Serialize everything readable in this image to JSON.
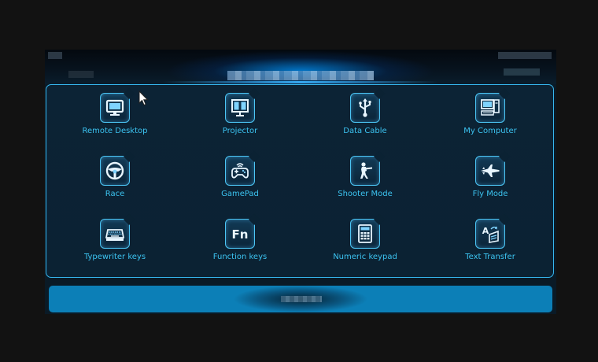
{
  "colors": {
    "accent": "#3cc3f0",
    "panel_bg": "#0b2233",
    "bottom_bar": "#0c7fb7"
  },
  "modes": [
    {
      "label": "Remote Desktop",
      "icon": "monitor-icon"
    },
    {
      "label": "Projector",
      "icon": "projector-icon"
    },
    {
      "label": "Data Cable",
      "icon": "usb-icon"
    },
    {
      "label": "My Computer",
      "icon": "computer-icon"
    },
    {
      "label": "Race",
      "icon": "steering-wheel-icon"
    },
    {
      "label": "GamePad",
      "icon": "gamepad-icon"
    },
    {
      "label": "Shooter Mode",
      "icon": "shooter-icon"
    },
    {
      "label": "Fly Mode",
      "icon": "jet-icon"
    },
    {
      "label": "Typewriter keys",
      "icon": "keyboard-icon"
    },
    {
      "label": "Function keys",
      "icon": "fn-key-icon"
    },
    {
      "label": "Numeric keypad",
      "icon": "calculator-icon"
    },
    {
      "label": "Text Transfer",
      "icon": "text-transfer-icon"
    }
  ],
  "icon_glyphs": {
    "fn_key": "Fn",
    "text_transfer": "A"
  }
}
